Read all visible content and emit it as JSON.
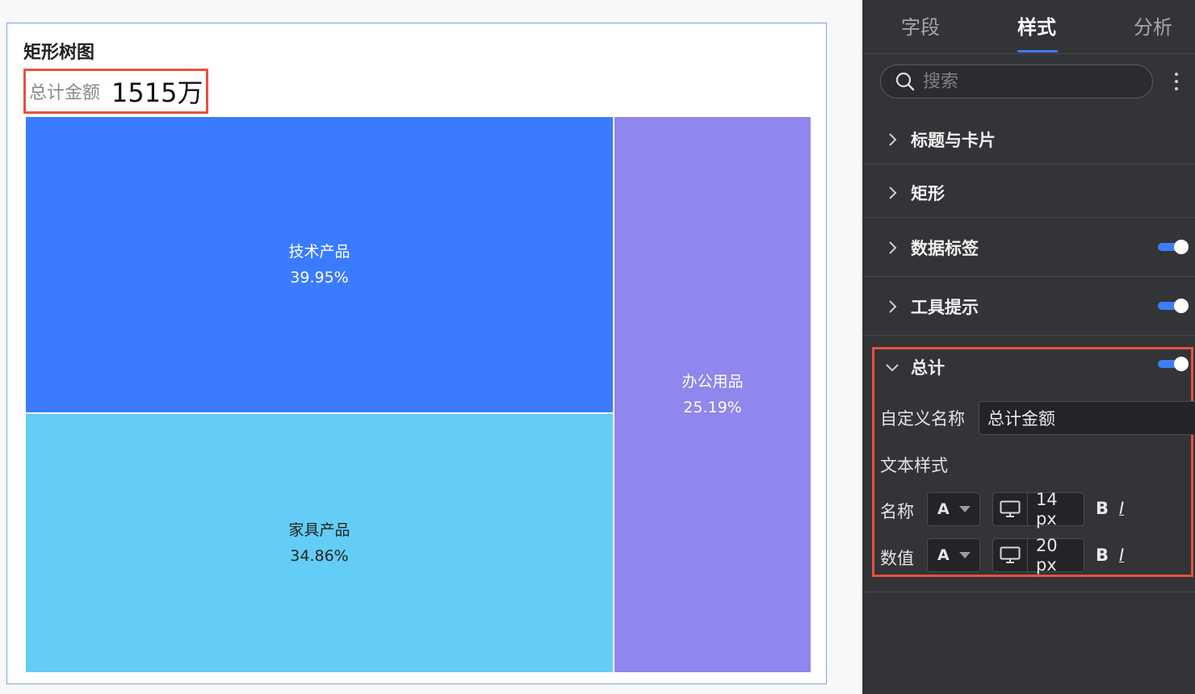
{
  "chart": {
    "title": "矩形树图",
    "total_name": "总计金额",
    "total_value": "1515万"
  },
  "chart_data": {
    "type": "treemap",
    "items": [
      {
        "label": "技术产品",
        "percent_label": "39.95%",
        "value": 39.95,
        "color": "#3a7bff",
        "text_color": "#ffffff"
      },
      {
        "label": "家具产品",
        "percent_label": "34.86%",
        "value": 34.86,
        "color": "#63cdf5",
        "text_color": "#222222"
      },
      {
        "label": "办公用品",
        "percent_label": "25.19%",
        "value": 25.19,
        "color": "#8f86ee",
        "text_color": "#ffffff"
      }
    ]
  },
  "panel": {
    "tabs": [
      {
        "label": "字段",
        "active": false
      },
      {
        "label": "样式",
        "active": true
      },
      {
        "label": "分析",
        "active": false
      }
    ],
    "search_placeholder": "搜索",
    "sections": [
      {
        "label": "标题与卡片",
        "expanded": false,
        "toggle": false
      },
      {
        "label": "矩形",
        "expanded": false,
        "toggle": false
      },
      {
        "label": "数据标签",
        "expanded": false,
        "toggle": true,
        "toggle_on": true
      },
      {
        "label": "工具提示",
        "expanded": false,
        "toggle": true,
        "toggle_on": true
      },
      {
        "label": "总计",
        "expanded": true,
        "toggle": true,
        "toggle_on": true
      }
    ],
    "total_settings": {
      "custom_name_label": "自定义名称",
      "custom_name_value": "总计金额",
      "text_style_label": "文本样式",
      "name_row_label": "名称",
      "value_row_label": "数值",
      "font_color_letter": "A",
      "name_font_size": "14 px",
      "value_font_size": "20 px",
      "bold_label": "B",
      "italic_label": "I"
    },
    "accent_color": "#3f7cf8",
    "highlight_color": "#e8513f"
  }
}
